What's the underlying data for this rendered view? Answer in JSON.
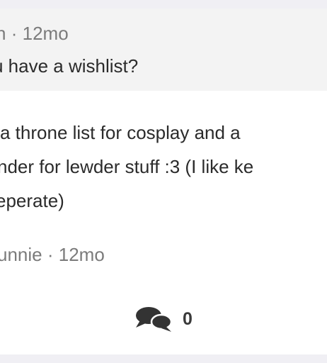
{
  "question": {
    "author_fragment": "n",
    "time": "12mo",
    "text_fragment": "u have a wishlist?"
  },
  "answer": {
    "lines": [
      "a throne list for cosplay and a",
      "nder for lewder stuff :3 (I like ke",
      "eperate)"
    ],
    "author_fragment": "unnie",
    "time": "12mo"
  },
  "comments": {
    "icon": "speech-bubbles-icon",
    "count": "0"
  },
  "meta_separator": "·"
}
